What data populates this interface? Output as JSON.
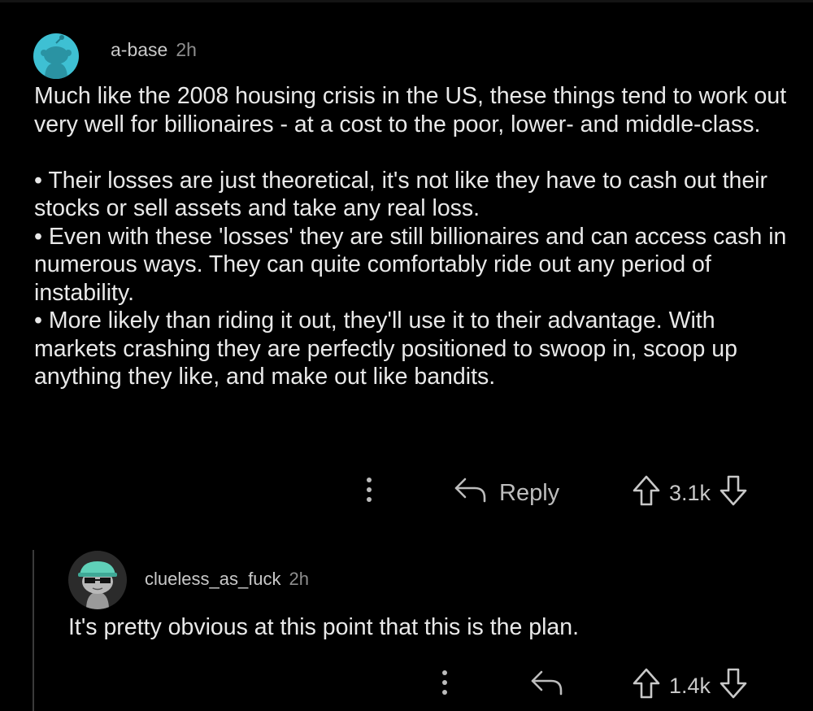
{
  "comments": [
    {
      "username": "a-base",
      "time": "2h",
      "paragraphs": [
        "Much like the 2008 housing crisis in the US, these things tend to work out very well for billionaires - at a cost to the poor, lower- and middle-class.",
        "• Their losses are just theoretical, it's not like they have to cash out their stocks or sell assets and take any real loss.",
        "• Even with these 'losses' they are still billionaires and can access cash in numerous ways. They can quite comfortably ride out any period of instability.",
        "• More likely than riding it out, they'll use it to their advantage. With markets crashing they are perfectly positioned to swoop in, scoop up anything they like, and make out like bandits."
      ],
      "reply_label": "Reply",
      "score": "3.1k"
    },
    {
      "username": "clueless_as_fuck",
      "time": "2h",
      "text": "It's pretty obvious at this point that this is the plan.",
      "score": "1.4k"
    }
  ],
  "icons": {
    "avatar_1": "snoo-avatar-icon",
    "avatar_2": "snoo-sunglasses-avatar-icon",
    "more": "more-options-icon",
    "reply": "reply-arrow-icon",
    "upvote": "upvote-arrow-icon",
    "downvote": "downvote-arrow-icon"
  },
  "colors": {
    "background": "#000000",
    "avatar_1_bg": "#3ec0d3",
    "avatar_2_cap": "#5fd0b8"
  }
}
